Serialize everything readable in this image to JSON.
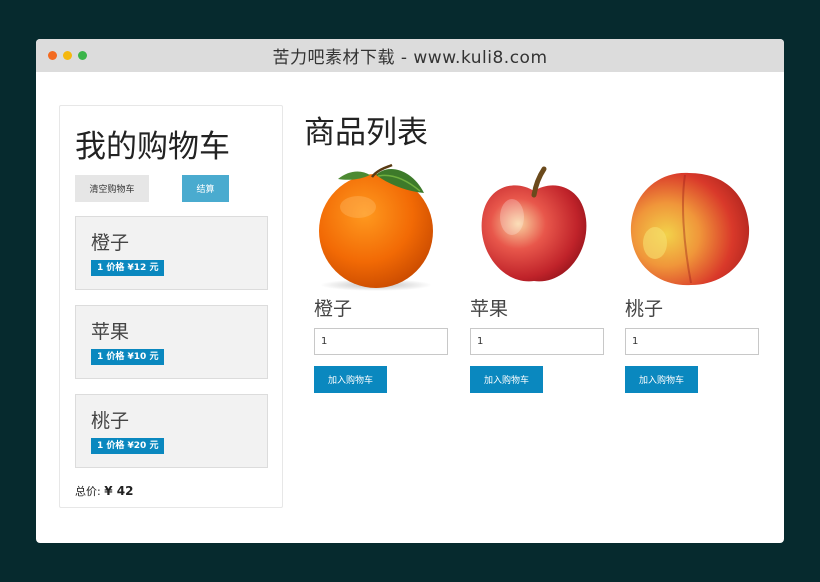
{
  "window": {
    "title": "苦力吧素材下载 - www.kuli8.com",
    "dots": [
      "#f36b21",
      "#f5b80f",
      "#3bb54a"
    ]
  },
  "cart": {
    "title": "我的购物车",
    "clear_label": "清空购物车",
    "checkout_label": "结算",
    "items": [
      {
        "name": "橙子",
        "badge": "1 价格 ¥12 元"
      },
      {
        "name": "苹果",
        "badge": "1 价格 ¥10 元"
      },
      {
        "name": "桃子",
        "badge": "1 价格 ¥20 元"
      }
    ],
    "total_label": "总价:",
    "total_value": "¥ 42"
  },
  "products": {
    "title": "商品列表",
    "add_label": "加入购物车",
    "items": [
      {
        "name": "橙子",
        "qty": "1",
        "image": "orange"
      },
      {
        "name": "苹果",
        "qty": "1",
        "image": "apple"
      },
      {
        "name": "桃子",
        "qty": "1",
        "image": "peach"
      }
    ]
  },
  "colors": {
    "accent": "#0a88bf",
    "checkout": "#4aabcf",
    "background": "#062a2e"
  }
}
